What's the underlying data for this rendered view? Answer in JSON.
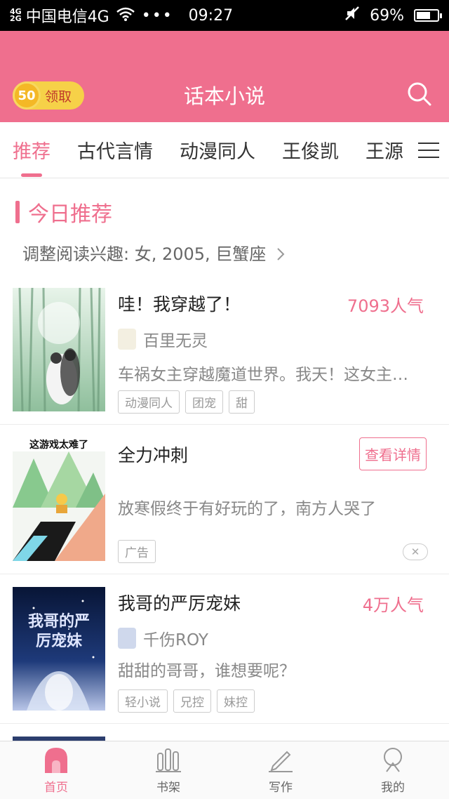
{
  "status_bar": {
    "signal_top": "4G",
    "signal_bottom": "2G",
    "carrier": "中国电信4G",
    "dots": "•••",
    "time": "09:27",
    "battery": "69%",
    "battery_level": 0.69
  },
  "header": {
    "coin_value": "50",
    "coin_label": "领取",
    "title": "话本小说"
  },
  "tabs": [
    "推荐",
    "古代言情",
    "动漫同人",
    "王俊凯",
    "王源"
  ],
  "section": {
    "title": "今日推荐",
    "interest_text": "调整阅读兴趣: 女, 2005, 巨蟹座"
  },
  "books": [
    {
      "title": "哇！我穿越了！",
      "popularity": "7093人气",
      "author": "百里无灵",
      "description": "车祸女主穿越魔道世界。我天！这女主…",
      "tags": [
        "动漫同人",
        "团宠",
        "甜"
      ]
    },
    {
      "title": "全力冲刺",
      "detail_label": "查看详情",
      "cover_text": "这游戏太难了",
      "description": "放寒假终于有好玩的了，南方人哭了",
      "ad_label": "广告",
      "close_label": "✕"
    },
    {
      "title": "我哥的严厉宠妹",
      "popularity": "4万人气",
      "author": "千伤ROY",
      "description": "甜甜的哥哥，谁想要呢？",
      "tags": [
        "轻小说",
        "兄控",
        "妹控"
      ],
      "cover_text_1": "我哥的严",
      "cover_text_2": "厉宠妹"
    }
  ],
  "bottom_nav": [
    "首页",
    "书架",
    "写作",
    "我的"
  ],
  "colors": {
    "accent": "#ef6f8e",
    "header_bg": "#ef6f8e",
    "coin": "#f6d148"
  }
}
